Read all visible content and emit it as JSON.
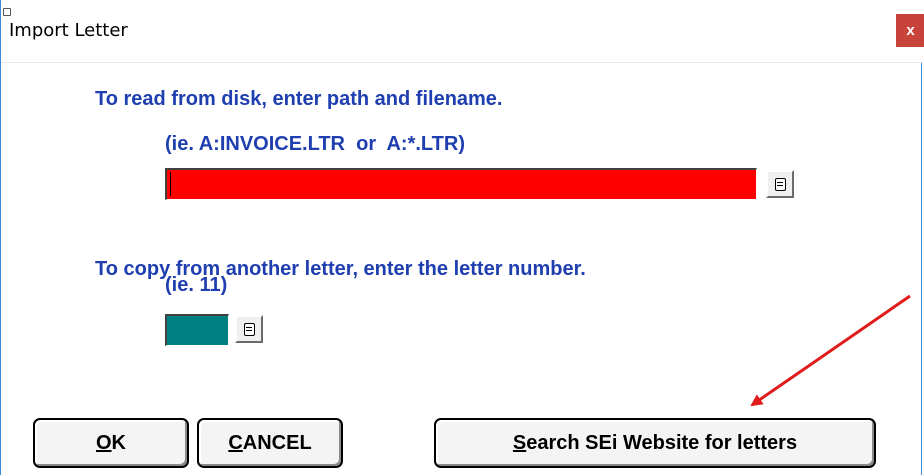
{
  "window": {
    "title": "Import Letter",
    "close_label": "x"
  },
  "disk_section": {
    "instruction": "To read from disk, enter path and filename.",
    "example": "(ie. A:INVOICE.LTR  or  A:*.LTR)",
    "path_value": "",
    "field_color": "#ff0000"
  },
  "copy_section": {
    "instruction": "To copy from another letter, enter the letter number.",
    "example": "(ie. 11)",
    "number_value": "",
    "field_color": "#008080"
  },
  "buttons": {
    "ok": {
      "hotkey": "O",
      "rest": "K"
    },
    "cancel": {
      "hotkey": "C",
      "rest": "ANCEL"
    },
    "search": {
      "hotkey": "S",
      "rest": "earch SEi Website for letters"
    }
  },
  "icons": {
    "lookup": "lookup-doc-icon",
    "close": "close-icon"
  },
  "colors": {
    "label_text": "#1f3fb0",
    "annotation_arrow": "#e01b1b"
  }
}
